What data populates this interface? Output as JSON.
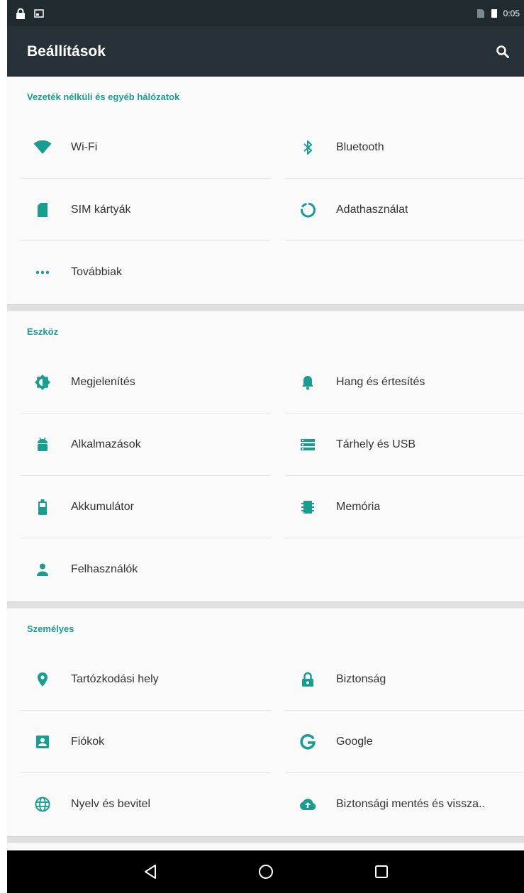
{
  "statusbar": {
    "time": "0:05"
  },
  "appbar": {
    "title": "Beállítások"
  },
  "colors": {
    "accent": "#1a9c8f",
    "appbar": "#263238",
    "statusbar": "#202b30"
  },
  "sections": {
    "wireless": {
      "title": "Vezeték nélküli és egyéb hálózatok",
      "items": [
        {
          "label": "Wi-Fi",
          "icon": "wifi-icon"
        },
        {
          "label": "Bluetooth",
          "icon": "bluetooth-icon"
        },
        {
          "label": "SIM kártyák",
          "icon": "sim-card-icon"
        },
        {
          "label": "Adathasználat",
          "icon": "data-usage-icon"
        },
        {
          "label": "Továbbiak",
          "icon": "more-icon"
        }
      ]
    },
    "device": {
      "title": "Eszköz",
      "items": [
        {
          "label": "Megjelenítés",
          "icon": "display-brightness-icon"
        },
        {
          "label": "Hang és értesítés",
          "icon": "bell-icon"
        },
        {
          "label": "Alkalmazások",
          "icon": "android-icon"
        },
        {
          "label": "Tárhely és USB",
          "icon": "storage-icon"
        },
        {
          "label": "Akkumulátor",
          "icon": "battery-icon"
        },
        {
          "label": "Memória",
          "icon": "memory-icon"
        },
        {
          "label": "Felhasználók",
          "icon": "person-icon"
        }
      ]
    },
    "personal": {
      "title": "Személyes",
      "items": [
        {
          "label": "Tartózkodási hely",
          "icon": "location-icon"
        },
        {
          "label": "Biztonság",
          "icon": "lock-icon"
        },
        {
          "label": "Fiókok",
          "icon": "account-box-icon"
        },
        {
          "label": "Google",
          "icon": "google-icon"
        },
        {
          "label": "Nyelv és bevitel",
          "icon": "globe-icon"
        },
        {
          "label": "Biztonsági mentés és vissza..",
          "icon": "cloud-upload-icon"
        }
      ]
    }
  }
}
